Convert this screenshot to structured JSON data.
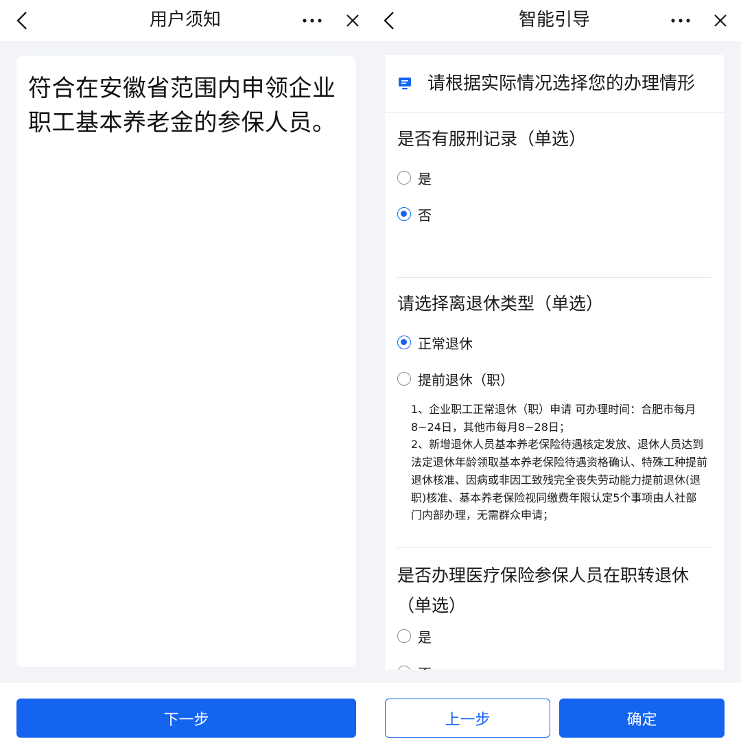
{
  "left_panel": {
    "title": "用户须知",
    "notice_text": "符合在安徽省范围内申领企业职工基本养老金的参保人员。",
    "next_button": "下一步"
  },
  "right_panel": {
    "title": "智能引导",
    "header_text": "请根据实际情况选择您的办理情形",
    "questions": [
      {
        "title": "是否有服刑记录（单选）",
        "options": [
          {
            "label": "是",
            "selected": false
          },
          {
            "label": "否",
            "selected": true
          }
        ]
      },
      {
        "title": "请选择离退休类型（单选）",
        "options": [
          {
            "label": "正常退休",
            "selected": true
          },
          {
            "label": "提前退休（职）",
            "selected": false
          }
        ],
        "notes": [
          "1、企业职工正常退休（职）申请 可办理时间：合肥市每月8~24日，其他市每月8~28日；",
          "2、新增退休人员基本养老保险待遇核定发放、退休人员达到法定退休年龄领取基本养老保险待遇资格确认、特殊工种提前退休核准、因病或非因工致残完全丧失劳动能力提前退休(退职)核准、基本养老保险视同缴费年限认定5个事项由人社部门内部办理，无需群众申请；"
        ]
      },
      {
        "title": "是否办理医疗保险参保人员在职转退休（单选）",
        "options": [
          {
            "label": "是",
            "selected": false
          },
          {
            "label": "否",
            "selected": false
          }
        ]
      }
    ],
    "prev_button": "上一步",
    "confirm_button": "确定"
  },
  "colors": {
    "primary": "#1464f0",
    "background": "#f2f4f7",
    "divider": "#e6e8eb"
  },
  "icons": [
    "back-arrow-icon",
    "more-dots-icon",
    "close-icon",
    "monitor-icon",
    "radio-icon"
  ]
}
